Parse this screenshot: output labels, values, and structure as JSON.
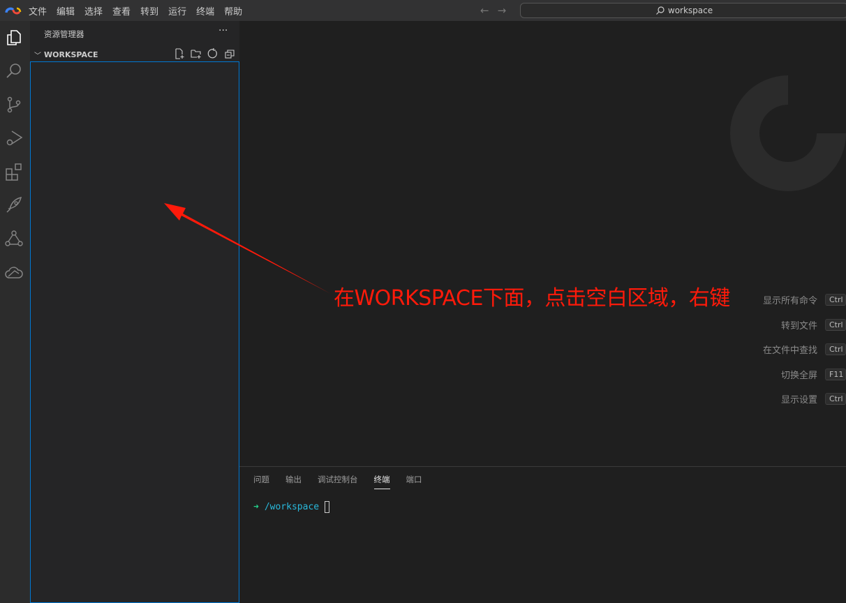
{
  "titlebar": {
    "menu": [
      "文件",
      "编辑",
      "选择",
      "查看",
      "转到",
      "运行",
      "终端",
      "帮助"
    ],
    "back_icon": "arrow-left-icon",
    "forward_icon": "arrow-right-icon",
    "search_text": "workspace"
  },
  "activity_bar": [
    "explorer-icon",
    "search-icon",
    "source-control-icon",
    "run-debug-icon",
    "extensions-icon",
    "rocket-icon",
    "share-icon",
    "cloud-icon"
  ],
  "sidebar": {
    "title": "资源管理器",
    "more": "···",
    "workspace_label": "WORKSPACE"
  },
  "editor": {
    "shortcuts": [
      {
        "label": "显示所有命令",
        "key": "Ctrl"
      },
      {
        "label": "转到文件",
        "key": "Ctrl"
      },
      {
        "label": "在文件中查找",
        "key": "Ctrl"
      },
      {
        "label": "切换全屏",
        "key": "F11"
      },
      {
        "label": "显示设置",
        "key": "Ctrl"
      }
    ]
  },
  "panel": {
    "tabs": [
      "问题",
      "输出",
      "调试控制台",
      "终端",
      "端口"
    ],
    "active_tab": "终端",
    "prompt_arrow": "➜",
    "prompt_path": "/workspace"
  },
  "annotation": {
    "text": "在WORKSPACE下面，点击空白区域，右键",
    "color": "#ff1a0a"
  }
}
